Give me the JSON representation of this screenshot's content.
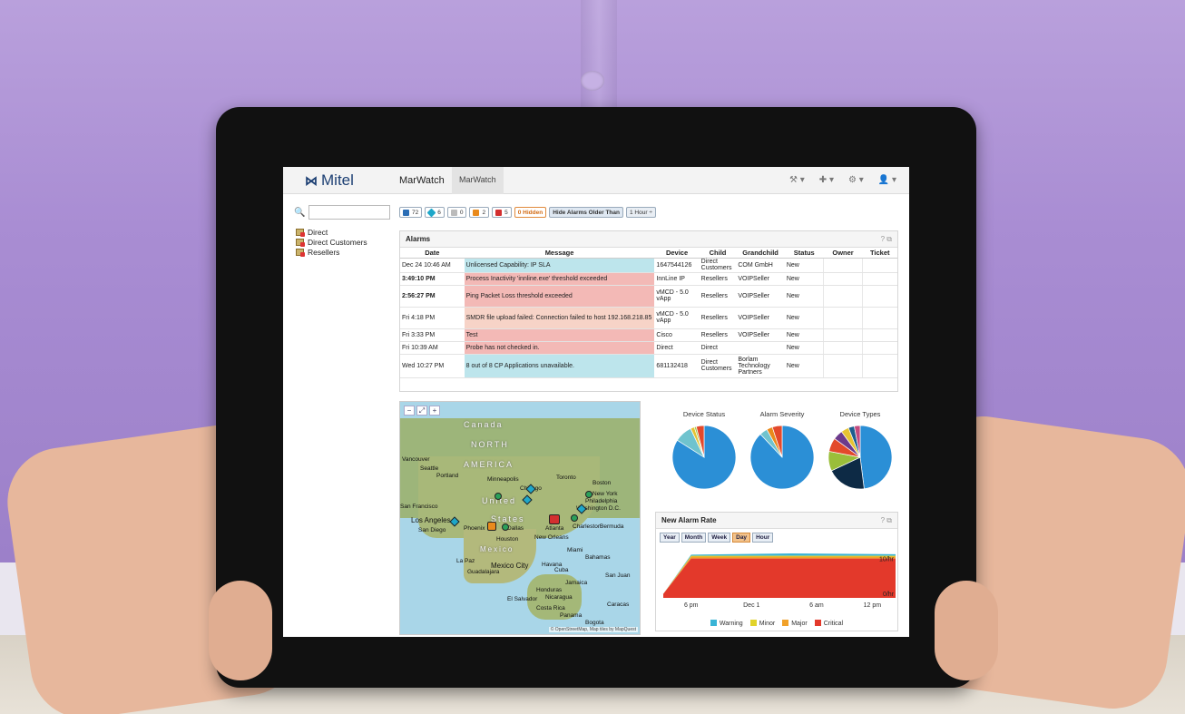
{
  "header": {
    "brand": "Mitel",
    "title": "MarWatch",
    "tab": "MarWatch",
    "tools": [
      "⚒ ▾",
      "✚ ▾",
      "⚙ ▾",
      "👤 ▾"
    ]
  },
  "search": {
    "placeholder": ""
  },
  "tree": {
    "items": [
      {
        "label": "Direct"
      },
      {
        "label": "Direct Customers"
      },
      {
        "label": "Resellers"
      }
    ]
  },
  "filters": {
    "counts": [
      {
        "icon": "info-icon",
        "value": "72",
        "color": "#2a6db5"
      },
      {
        "icon": "diamond-icon",
        "value": "6",
        "color": "#1ea7c9"
      },
      {
        "icon": "warning-icon-grey",
        "value": "0",
        "color": "#bbbbbb"
      },
      {
        "icon": "warning-icon-orange",
        "value": "2",
        "color": "#e98a1c"
      },
      {
        "icon": "warning-icon-red",
        "value": "5",
        "color": "#d32f2f"
      }
    ],
    "hidden_label": "0 Hidden",
    "older_label": "Hide Alarms Older Than",
    "hour_label": "1 Hour ÷"
  },
  "alarms": {
    "title": "Alarms",
    "actions": "? ⧉",
    "columns": [
      "Date",
      "Message",
      "Device",
      "Child",
      "Grandchild",
      "Status",
      "Owner",
      "Ticket"
    ],
    "rows": [
      {
        "date": "Dec 24 10:46 AM",
        "message": "Unlicensed Capability: IP SLA",
        "device": "1647544126",
        "child": "Direct Customers",
        "grandchild": "COM GmbH",
        "status": "New",
        "owner": "",
        "ticket": ""
      },
      {
        "date": "3:49:10 PM",
        "message": "Process Inactivity 'innline.exe' threshold exceeded",
        "device": "InnLine IP",
        "child": "Resellers",
        "grandchild": "VOIPSeller",
        "status": "New",
        "owner": "",
        "ticket": ""
      },
      {
        "date": "2:56:27 PM",
        "message": "Ping Packet Loss threshold exceeded",
        "device": "vMCD - 5.0 vApp",
        "child": "Resellers",
        "grandchild": "VOIPSeller",
        "status": "New",
        "owner": "",
        "ticket": ""
      },
      {
        "date": "Fri 4:18 PM",
        "message": "SMDR file upload failed: Connection failed to host 192.168.218.85",
        "device": "vMCD - 5.0 vApp",
        "child": "Resellers",
        "grandchild": "VOIPSeller",
        "status": "New",
        "owner": "",
        "ticket": ""
      },
      {
        "date": "Fri 3:33 PM",
        "message": "Test",
        "device": "Cisco",
        "child": "Resellers",
        "grandchild": "VOIPSeller",
        "status": "New",
        "owner": "",
        "ticket": ""
      },
      {
        "date": "Fri 10:39 AM",
        "message": "Probe has not checked in.",
        "device": "Direct",
        "child": "Direct",
        "grandchild": "",
        "status": "New",
        "owner": "",
        "ticket": ""
      },
      {
        "date": "Wed 10:27 PM",
        "message": "8 out of 8 CP Applications unavailable.",
        "device": "681132418",
        "child": "Direct Customers",
        "grandchild": "Borlam Technology Partners",
        "status": "New",
        "owner": "",
        "ticket": ""
      }
    ]
  },
  "map": {
    "controls": [
      "−",
      "⤢",
      "+"
    ],
    "labels": [
      "Canada",
      "NORTH",
      "AMERICA",
      "United",
      "States",
      "Mexico"
    ],
    "cities": [
      "Vancouver",
      "Seattle",
      "Portland",
      "Minneapolis",
      "Chicago",
      "Toronto",
      "Boston",
      "New York",
      "Philadelphia",
      "Washington D.C.",
      "San Francisco",
      "Los Angeles",
      "San Diego",
      "Phoenix",
      "Dallas",
      "Houston",
      "New Orleans",
      "Atlanta",
      "Charleston",
      "Miami",
      "Havana",
      "Cuba",
      "Mexico City",
      "Guadalajara",
      "La Paz",
      "Bermuda",
      "Bahamas",
      "San Juan",
      "Jamaica",
      "Caracas",
      "Honduras",
      "Nicaragua",
      "El Salvador",
      "Costa Rica",
      "Panama",
      "Bogota"
    ],
    "attribution": "© OpenStreetMap, Map tiles by MapQuest"
  },
  "pies": [
    {
      "title": "Device Status",
      "slices": [
        {
          "v": 84,
          "c": "#2b8fd6"
        },
        {
          "v": 9,
          "c": "#6fc3ce"
        },
        {
          "v": 2,
          "c": "#e6c333"
        },
        {
          "v": 1,
          "c": "#a0c94e"
        },
        {
          "v": 4,
          "c": "#e3492b"
        }
      ]
    },
    {
      "title": "Alarm Severity",
      "slices": [
        {
          "v": 88,
          "c": "#2b8fd6"
        },
        {
          "v": 4,
          "c": "#6fc3ce"
        },
        {
          "v": 3,
          "c": "#e98a1c"
        },
        {
          "v": 5,
          "c": "#e3492b"
        }
      ]
    },
    {
      "title": "Device Types",
      "slices": [
        {
          "v": 48,
          "c": "#2b8fd6"
        },
        {
          "v": 20,
          "c": "#0d2a45"
        },
        {
          "v": 10,
          "c": "#9abe3a"
        },
        {
          "v": 7,
          "c": "#e3492b"
        },
        {
          "v": 5,
          "c": "#6c3a8c"
        },
        {
          "v": 4,
          "c": "#e6c333"
        },
        {
          "v": 3,
          "c": "#1e5e8e"
        },
        {
          "v": 3,
          "c": "#c34a7e"
        }
      ]
    }
  ],
  "rate": {
    "title": "New Alarm Rate",
    "actions": "? ⧉",
    "ranges": [
      "Year",
      "Month",
      "Week",
      "Day",
      "Hour"
    ],
    "active_range": "Day",
    "ticks_x": [
      "6 pm",
      "Dec 1",
      "6 am",
      "12 pm"
    ],
    "ticks_y": [
      "10/hr",
      "0/hr"
    ],
    "legend": [
      {
        "label": "Warning",
        "color": "#39b4d6"
      },
      {
        "label": "Minor",
        "color": "#e1d32a"
      },
      {
        "label": "Major",
        "color": "#f1a12a"
      },
      {
        "label": "Critical",
        "color": "#e3392b"
      }
    ]
  },
  "chart_data": {
    "type": "area",
    "title": "New Alarm Rate",
    "xlabel": "",
    "ylabel": "",
    "categories": [
      "6 pm",
      "Dec 1",
      "6 am",
      "12 pm"
    ],
    "series": [
      {
        "name": "Critical",
        "values": [
          1,
          10,
          10,
          10
        ]
      },
      {
        "name": "Major",
        "values": [
          0,
          0.5,
          0.5,
          0.5
        ]
      },
      {
        "name": "Minor",
        "values": [
          0,
          0.2,
          0.2,
          0.2
        ]
      },
      {
        "name": "Warning",
        "values": [
          0,
          0.3,
          0.6,
          0.4
        ]
      }
    ],
    "ylim": [
      0,
      12
    ]
  }
}
